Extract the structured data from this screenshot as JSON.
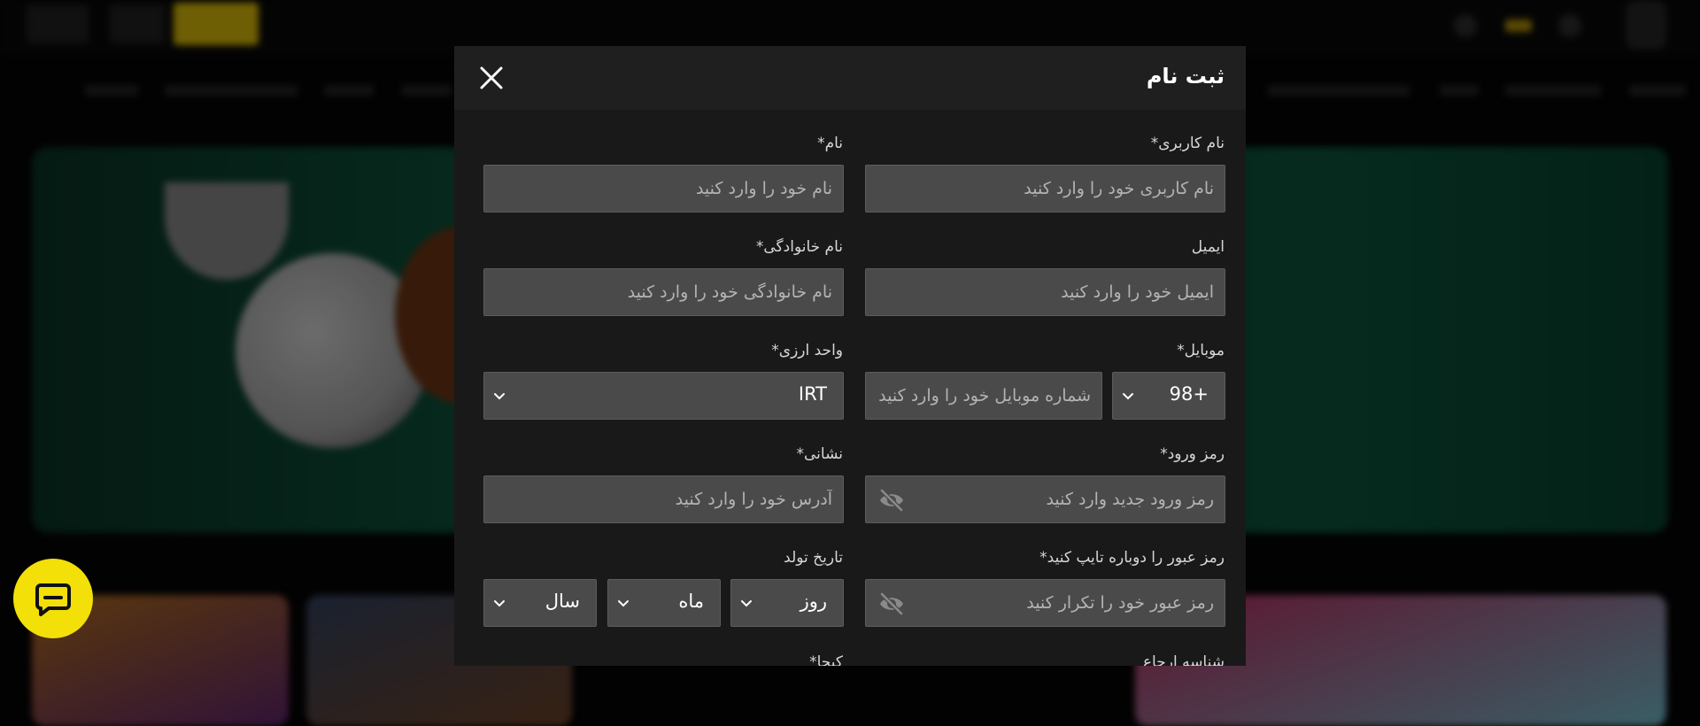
{
  "modal": {
    "title": "ثبت نام",
    "fields": {
      "username": {
        "label": "نام کاربری*",
        "placeholder": "نام کاربری خود را وارد کنید"
      },
      "first_name": {
        "label": "نام*",
        "placeholder": "نام خود را وارد کنید"
      },
      "email": {
        "label": "ایمیل",
        "placeholder": "ایمیل خود را وارد کنید"
      },
      "last_name": {
        "label": "نام خانوادگی*",
        "placeholder": "نام خانوادگی خود را وارد کنید"
      },
      "mobile": {
        "label": "موبایل*",
        "code": "98+",
        "placeholder": "شماره موبایل خود را وارد کنید"
      },
      "currency": {
        "label": "واحد ارزی*",
        "value": "IRT"
      },
      "password": {
        "label": "رمز ورود*",
        "placeholder": "رمز ورود جدید وارد کنید"
      },
      "address": {
        "label": "نشانی*",
        "placeholder": "آدرس خود را وارد کنید"
      },
      "password_repeat": {
        "label": "رمز عبور را دوباره تایپ کنید*",
        "placeholder": "رمز عبور خود را تکرار کنید"
      },
      "birthdate": {
        "label": "تاریخ تولد",
        "day": "روز",
        "month": "ماه",
        "year": "سال"
      },
      "referral": {
        "label": "شناسه ارجاع"
      },
      "captcha": {
        "label": "کپچا*"
      }
    }
  },
  "icons": {
    "close": "close-icon",
    "chevron": "chevron-down-icon",
    "eye": "eye-off-icon",
    "chat": "chat-icon"
  },
  "colors": {
    "accent": "#f2e008",
    "input_bg": "#4a4a4a",
    "modal_bg": "#1c1c1c"
  }
}
